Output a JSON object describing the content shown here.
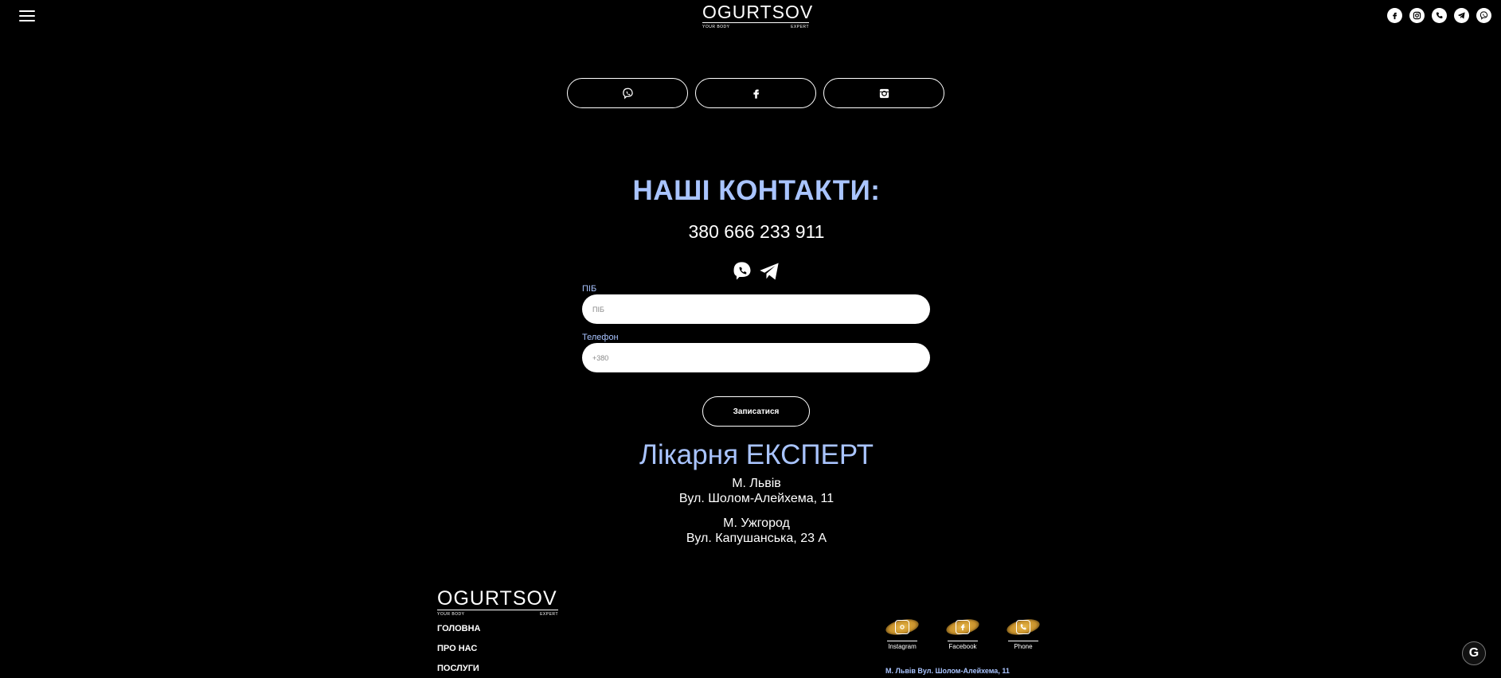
{
  "header": {
    "logo_word": "OGURTSOV",
    "logo_sub_left": "YOUR BODY",
    "logo_sub_right": "EXPERT",
    "social_icons": [
      "facebook-icon",
      "instagram-icon",
      "phone-icon",
      "telegram-icon",
      "viber-icon"
    ]
  },
  "pill_buttons": [
    "viber-icon",
    "facebook-icon",
    "instagram-icon"
  ],
  "contacts": {
    "title": "НАШІ КОНТАКТИ:",
    "phone": "380 666 233 911",
    "messengers": [
      "viber-icon",
      "telegram-icon"
    ]
  },
  "form": {
    "name_label": "ПІБ",
    "name_placeholder": "ПІБ",
    "phone_label": "Телефон",
    "phone_placeholder": "+380",
    "submit_label": "Записатися"
  },
  "clinic": {
    "title": "Лікарня ЕКСПЕРТ",
    "addresses": [
      {
        "city": "М. Львів",
        "street": "Вул. Шолом-Алейхема, 11"
      },
      {
        "city": "М. Ужгород",
        "street": "Вул. Капушанська, 23 А"
      }
    ]
  },
  "footer": {
    "logo_word": "OGURTSOV",
    "logo_sub_left": "YOUR BODY",
    "logo_sub_right": "EXPERT",
    "nav": [
      "ГОЛОВНА",
      "ПРО НАС",
      "ПОСЛУГИ"
    ],
    "social": [
      {
        "label": "Instagram",
        "icon": "instagram-icon"
      },
      {
        "label": "Facebook",
        "icon": "facebook-icon"
      },
      {
        "label": "Phone",
        "icon": "phone-icon"
      }
    ],
    "address": "М. Львів Вул. Шолом-Алейхема, 11"
  },
  "colors": {
    "background": "#000000",
    "accent": "#a9c4ff",
    "text": "#ffffff",
    "gold": "#e9b94b"
  }
}
